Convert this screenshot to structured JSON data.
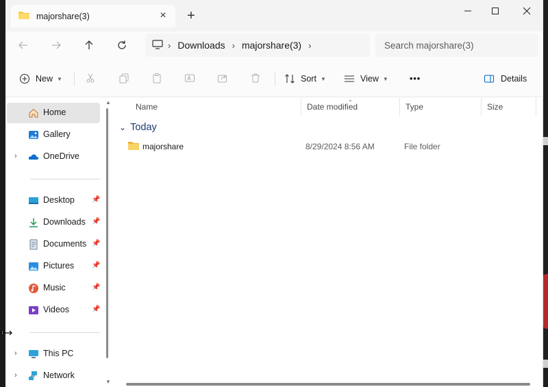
{
  "tab": {
    "title": "majorshare(3)",
    "icon": "folder-icon"
  },
  "window_controls": {
    "minimize": "minimize-icon",
    "maximize": "maximize-icon",
    "close": "close-icon"
  },
  "address": {
    "crumbs": [
      "Downloads",
      "majorshare(3)"
    ],
    "search_placeholder": "Search majorshare(3)"
  },
  "toolbar": {
    "new_label": "New",
    "sort_label": "Sort",
    "view_label": "View",
    "more_label": "•••",
    "details_label": "Details"
  },
  "sidebar": {
    "items": [
      {
        "label": "Home",
        "icon": "home-icon",
        "active": true
      },
      {
        "label": "Gallery",
        "icon": "gallery-icon"
      },
      {
        "label": "OneDrive",
        "icon": "onedrive-icon",
        "expandable": true
      }
    ],
    "quick_access": [
      {
        "label": "Desktop",
        "icon": "desktop-icon",
        "pinned": true
      },
      {
        "label": "Downloads",
        "icon": "downloads-icon",
        "pinned": true
      },
      {
        "label": "Documents",
        "icon": "documents-icon",
        "pinned": true
      },
      {
        "label": "Pictures",
        "icon": "pictures-icon",
        "pinned": true
      },
      {
        "label": "Music",
        "icon": "music-icon",
        "pinned": true
      },
      {
        "label": "Videos",
        "icon": "videos-icon",
        "pinned": true
      }
    ],
    "devices": [
      {
        "label": "This PC",
        "icon": "this-pc-icon",
        "expandable": true
      },
      {
        "label": "Network",
        "icon": "network-icon",
        "expandable": true
      }
    ]
  },
  "columns": [
    "Name",
    "Date modified",
    "Type",
    "Size"
  ],
  "group": {
    "label": "Today"
  },
  "files": [
    {
      "name": "majorshare",
      "date_modified": "8/29/2024 8:56 AM",
      "type": "File folder",
      "size": ""
    }
  ],
  "colors": {
    "accent": "#0067c0",
    "group_text": "#1f3b70",
    "folder": "#f8c94a"
  }
}
